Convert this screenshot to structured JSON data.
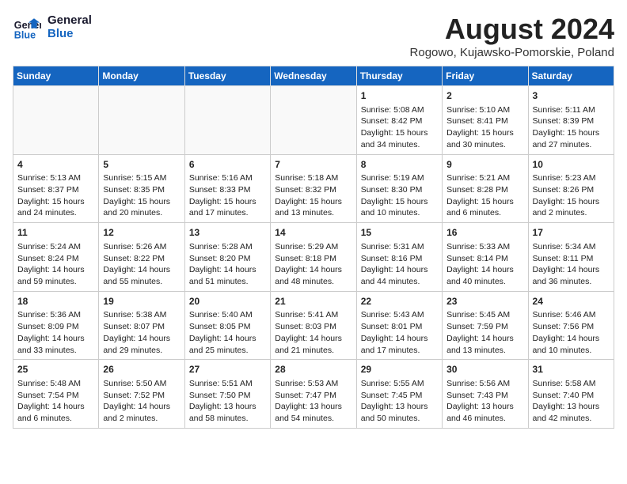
{
  "header": {
    "logo_line1": "General",
    "logo_line2": "Blue",
    "month_year": "August 2024",
    "location": "Rogowo, Kujawsko-Pomorskie, Poland"
  },
  "days_of_week": [
    "Sunday",
    "Monday",
    "Tuesday",
    "Wednesday",
    "Thursday",
    "Friday",
    "Saturday"
  ],
  "weeks": [
    [
      {
        "day": "",
        "info": ""
      },
      {
        "day": "",
        "info": ""
      },
      {
        "day": "",
        "info": ""
      },
      {
        "day": "",
        "info": ""
      },
      {
        "day": "1",
        "info": "Sunrise: 5:08 AM\nSunset: 8:42 PM\nDaylight: 15 hours\nand 34 minutes."
      },
      {
        "day": "2",
        "info": "Sunrise: 5:10 AM\nSunset: 8:41 PM\nDaylight: 15 hours\nand 30 minutes."
      },
      {
        "day": "3",
        "info": "Sunrise: 5:11 AM\nSunset: 8:39 PM\nDaylight: 15 hours\nand 27 minutes."
      }
    ],
    [
      {
        "day": "4",
        "info": "Sunrise: 5:13 AM\nSunset: 8:37 PM\nDaylight: 15 hours\nand 24 minutes."
      },
      {
        "day": "5",
        "info": "Sunrise: 5:15 AM\nSunset: 8:35 PM\nDaylight: 15 hours\nand 20 minutes."
      },
      {
        "day": "6",
        "info": "Sunrise: 5:16 AM\nSunset: 8:33 PM\nDaylight: 15 hours\nand 17 minutes."
      },
      {
        "day": "7",
        "info": "Sunrise: 5:18 AM\nSunset: 8:32 PM\nDaylight: 15 hours\nand 13 minutes."
      },
      {
        "day": "8",
        "info": "Sunrise: 5:19 AM\nSunset: 8:30 PM\nDaylight: 15 hours\nand 10 minutes."
      },
      {
        "day": "9",
        "info": "Sunrise: 5:21 AM\nSunset: 8:28 PM\nDaylight: 15 hours\nand 6 minutes."
      },
      {
        "day": "10",
        "info": "Sunrise: 5:23 AM\nSunset: 8:26 PM\nDaylight: 15 hours\nand 2 minutes."
      }
    ],
    [
      {
        "day": "11",
        "info": "Sunrise: 5:24 AM\nSunset: 8:24 PM\nDaylight: 14 hours\nand 59 minutes."
      },
      {
        "day": "12",
        "info": "Sunrise: 5:26 AM\nSunset: 8:22 PM\nDaylight: 14 hours\nand 55 minutes."
      },
      {
        "day": "13",
        "info": "Sunrise: 5:28 AM\nSunset: 8:20 PM\nDaylight: 14 hours\nand 51 minutes."
      },
      {
        "day": "14",
        "info": "Sunrise: 5:29 AM\nSunset: 8:18 PM\nDaylight: 14 hours\nand 48 minutes."
      },
      {
        "day": "15",
        "info": "Sunrise: 5:31 AM\nSunset: 8:16 PM\nDaylight: 14 hours\nand 44 minutes."
      },
      {
        "day": "16",
        "info": "Sunrise: 5:33 AM\nSunset: 8:14 PM\nDaylight: 14 hours\nand 40 minutes."
      },
      {
        "day": "17",
        "info": "Sunrise: 5:34 AM\nSunset: 8:11 PM\nDaylight: 14 hours\nand 36 minutes."
      }
    ],
    [
      {
        "day": "18",
        "info": "Sunrise: 5:36 AM\nSunset: 8:09 PM\nDaylight: 14 hours\nand 33 minutes."
      },
      {
        "day": "19",
        "info": "Sunrise: 5:38 AM\nSunset: 8:07 PM\nDaylight: 14 hours\nand 29 minutes."
      },
      {
        "day": "20",
        "info": "Sunrise: 5:40 AM\nSunset: 8:05 PM\nDaylight: 14 hours\nand 25 minutes."
      },
      {
        "day": "21",
        "info": "Sunrise: 5:41 AM\nSunset: 8:03 PM\nDaylight: 14 hours\nand 21 minutes."
      },
      {
        "day": "22",
        "info": "Sunrise: 5:43 AM\nSunset: 8:01 PM\nDaylight: 14 hours\nand 17 minutes."
      },
      {
        "day": "23",
        "info": "Sunrise: 5:45 AM\nSunset: 7:59 PM\nDaylight: 14 hours\nand 13 minutes."
      },
      {
        "day": "24",
        "info": "Sunrise: 5:46 AM\nSunset: 7:56 PM\nDaylight: 14 hours\nand 10 minutes."
      }
    ],
    [
      {
        "day": "25",
        "info": "Sunrise: 5:48 AM\nSunset: 7:54 PM\nDaylight: 14 hours\nand 6 minutes."
      },
      {
        "day": "26",
        "info": "Sunrise: 5:50 AM\nSunset: 7:52 PM\nDaylight: 14 hours\nand 2 minutes."
      },
      {
        "day": "27",
        "info": "Sunrise: 5:51 AM\nSunset: 7:50 PM\nDaylight: 13 hours\nand 58 minutes."
      },
      {
        "day": "28",
        "info": "Sunrise: 5:53 AM\nSunset: 7:47 PM\nDaylight: 13 hours\nand 54 minutes."
      },
      {
        "day": "29",
        "info": "Sunrise: 5:55 AM\nSunset: 7:45 PM\nDaylight: 13 hours\nand 50 minutes."
      },
      {
        "day": "30",
        "info": "Sunrise: 5:56 AM\nSunset: 7:43 PM\nDaylight: 13 hours\nand 46 minutes."
      },
      {
        "day": "31",
        "info": "Sunrise: 5:58 AM\nSunset: 7:40 PM\nDaylight: 13 hours\nand 42 minutes."
      }
    ]
  ]
}
